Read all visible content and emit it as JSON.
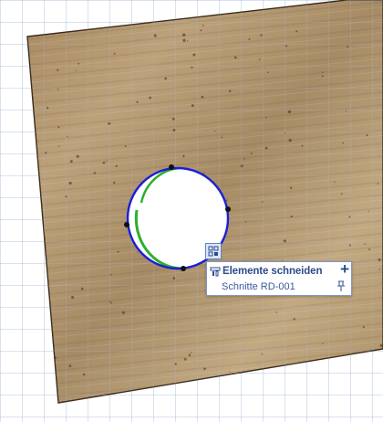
{
  "popup": {
    "title": "Elemente schneiden",
    "item": "Schnitte RD-001",
    "add_icon": "plus-icon",
    "pin_icon": "pin-icon",
    "header_icon": "cut-elements-icon"
  },
  "icons": {
    "trigger": "element-group-icon"
  },
  "colors": {
    "accent": "#2b4b8c",
    "circle_blue": "#1b1fd6",
    "circle_green": "#2bb02b",
    "canvas_grid": "#96aad2"
  }
}
